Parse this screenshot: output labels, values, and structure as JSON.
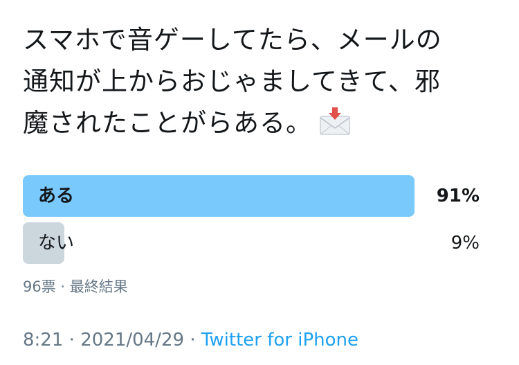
{
  "tweet": {
    "line1": "スマホで音ゲーしてたら、メールの",
    "line2": "通知が上からおじゃましてきて、邪",
    "line3": "魔されたことがらある。",
    "emoji_icon": "incoming-envelope-icon"
  },
  "poll": {
    "options": [
      {
        "label": "ある",
        "percent": "91%",
        "fraction": 0.91,
        "bar_color": "#79c9fd",
        "winner": true
      },
      {
        "label": "ない",
        "percent": "9%",
        "fraction": 0.09,
        "bar_color": "#ccd6dd",
        "winner": false
      }
    ],
    "summary": "96票 · 最終結果"
  },
  "meta": {
    "time": "8:21",
    "separator": "·",
    "date": "2021/04/29",
    "source": "Twitter for iPhone"
  },
  "colors": {
    "text": "#14171a",
    "secondary": "#657786",
    "link": "#1da1f2"
  }
}
